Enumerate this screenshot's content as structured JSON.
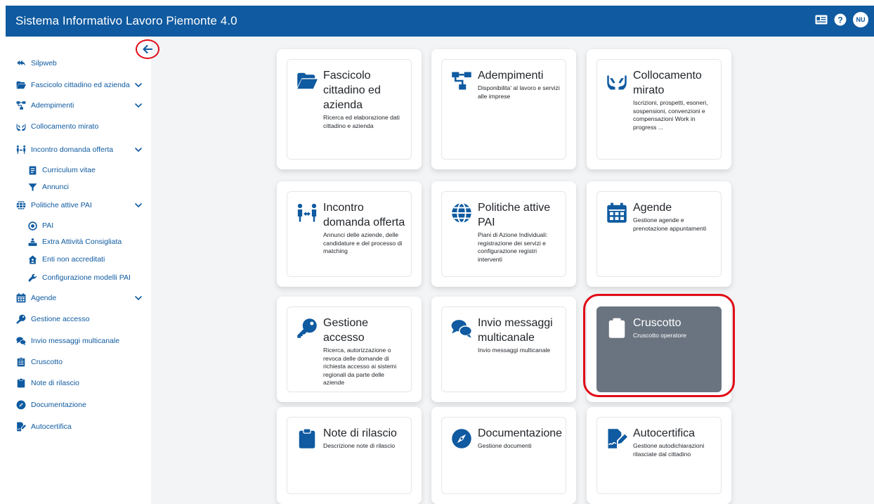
{
  "header": {
    "title": "Sistema Informativo Lavoro Piemonte 4.0",
    "icons": [
      "id-card-icon",
      "help-icon"
    ],
    "user_initials": "NU"
  },
  "sidebar": {
    "items": [
      {
        "label": "Silpweb",
        "icon": "reply-all-icon",
        "level": 1,
        "expandable": false
      },
      {
        "label": "Fascicolo cittadino ed azienda",
        "icon": "folder-open-icon",
        "level": 1,
        "expandable": true
      },
      {
        "label": "Adempimenti",
        "icon": "sitemap-icon",
        "level": 1,
        "expandable": true
      },
      {
        "label": "Collocamento mirato",
        "icon": "hands-icon",
        "level": 1,
        "expandable": false
      },
      {
        "label": "Incontro domanda offerta",
        "icon": "people-exchange-icon",
        "level": 1,
        "expandable": true
      },
      {
        "label": "Curriculum vitae",
        "icon": "document-icon",
        "level": 2,
        "expandable": false
      },
      {
        "label": "Annunci",
        "icon": "filter-icon",
        "level": 2,
        "expandable": false
      },
      {
        "label": "Politiche attive PAI",
        "icon": "globe-icon",
        "level": 1,
        "expandable": true
      },
      {
        "label": "PAI",
        "icon": "target-icon",
        "level": 2,
        "expandable": false
      },
      {
        "label": "Extra Attività Consigliata",
        "icon": "person-box-icon",
        "level": 2,
        "expandable": false
      },
      {
        "label": "Enti non accreditati",
        "icon": "house-user-icon",
        "level": 2,
        "expandable": false
      },
      {
        "label": "Configurazione modelli PAI",
        "icon": "wrench-icon",
        "level": 2,
        "expandable": false
      },
      {
        "label": "Agende",
        "icon": "calendar-icon",
        "level": 1,
        "expandable": true
      },
      {
        "label": "Gestione accesso",
        "icon": "key-icon",
        "level": 1,
        "expandable": false
      },
      {
        "label": "Invio messaggi multicanale",
        "icon": "chat-icon",
        "level": 1,
        "expandable": false
      },
      {
        "label": "Cruscotto",
        "icon": "clipboard-list-icon",
        "level": 1,
        "expandable": false
      },
      {
        "label": "Note di rilascio",
        "icon": "clipboard-icon",
        "level": 1,
        "expandable": false
      },
      {
        "label": "Documentazione",
        "icon": "compass-icon",
        "level": 1,
        "expandable": false
      },
      {
        "label": "Autocertifica",
        "icon": "signature-icon",
        "level": 1,
        "expandable": false
      }
    ]
  },
  "cards": [
    {
      "title": "Fascicolo cittadino ed azienda",
      "desc": "Ricerca ed elaborazione dati cittadino e azienda",
      "icon": "folder-open-icon",
      "active": false
    },
    {
      "title": "Adempimenti",
      "desc": "Disponibilita' al lavoro e servizi alle imprese",
      "icon": "sitemap-icon",
      "active": false
    },
    {
      "title": "Collocamento mirato",
      "desc": "Iscrizioni, prospetti, esoneri, sospensioni, convenzioni e compensazioni Work in progress ...",
      "icon": "hands-icon",
      "active": false
    },
    {
      "title": "Incontro domanda offerta",
      "desc": "Annunci delle aziende, delle candidature e del processo di matching",
      "icon": "people-exchange-icon",
      "active": false
    },
    {
      "title": "Politiche attive PAI",
      "desc": "Piani di Azione Individuali: registrazione dei servizi e configurazione registri interventi",
      "icon": "globe-icon",
      "active": false
    },
    {
      "title": "Agende",
      "desc": "Gestione agende e prenotazione appuntamenti",
      "icon": "calendar-icon",
      "active": false
    },
    {
      "title": "Gestione accesso",
      "desc": "Ricerca, autorizzazione o revoca delle domande di richiesta accesso ai sistemi regionali da parte delle aziende",
      "icon": "key-icon",
      "active": false
    },
    {
      "title": "Invio messaggi multicanale",
      "desc": "Invio messaggi multicanale",
      "icon": "chat-icon",
      "active": false
    },
    {
      "title": "Cruscotto",
      "desc": "Cruscotto operatore",
      "icon": "clipboard-list-icon",
      "active": true
    },
    {
      "title": "Note di rilascio",
      "desc": "Descrizione note di rilascio",
      "icon": "clipboard-icon",
      "active": false
    },
    {
      "title": "Documentazione",
      "desc": "Gestione documenti",
      "icon": "compass-icon",
      "active": false
    },
    {
      "title": "Autocertifica",
      "desc": "Gestione autodichiarazioni rilasciate dal cittadino",
      "icon": "signature-icon",
      "active": false
    }
  ],
  "colors": {
    "brand": "#0f5aa0",
    "active_card": "#6a7480",
    "annotation": "#e10b16"
  }
}
